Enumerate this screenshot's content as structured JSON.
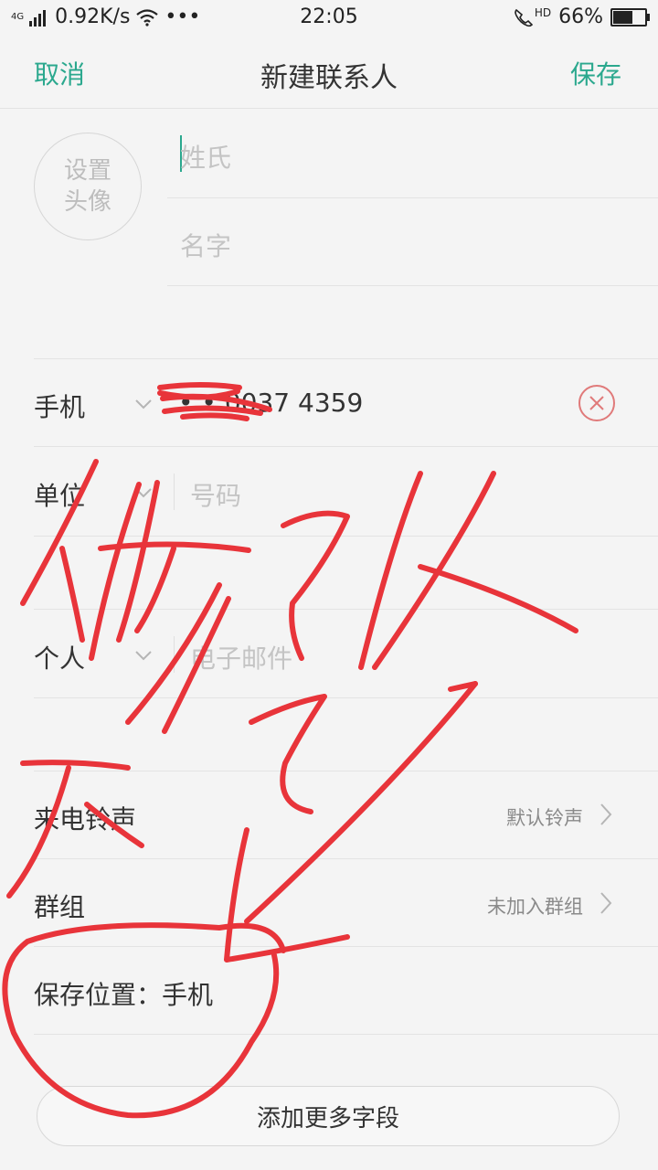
{
  "status_bar": {
    "network": "4G",
    "speed": "0.92K/s",
    "more": "•••",
    "time": "22:05",
    "hd": "HD",
    "battery_text": "66%",
    "battery_level": 0.66
  },
  "header": {
    "cancel_label": "取消",
    "title": "新建联系人",
    "save_label": "保存"
  },
  "avatar": {
    "line1": "设置",
    "line2": "头像"
  },
  "name": {
    "surname_placeholder": "姓氏",
    "given_placeholder": "名字"
  },
  "rows": {
    "mobile": {
      "label": "手机",
      "value": "0037 4359"
    },
    "work": {
      "label": "单位",
      "placeholder": "号码"
    },
    "personal": {
      "label": "个人",
      "placeholder": "电子邮件"
    },
    "ringtone": {
      "label": "来电铃声",
      "value": "默认铃声"
    },
    "group": {
      "label": "群组",
      "value": "未加入群组"
    },
    "storage": {
      "label": "保存位置：手机"
    }
  },
  "add_field_label": "添加更多字段",
  "colors": {
    "accent": "#2ba88e",
    "scribble": "#e8343a",
    "clear": "#e07a7a"
  }
}
